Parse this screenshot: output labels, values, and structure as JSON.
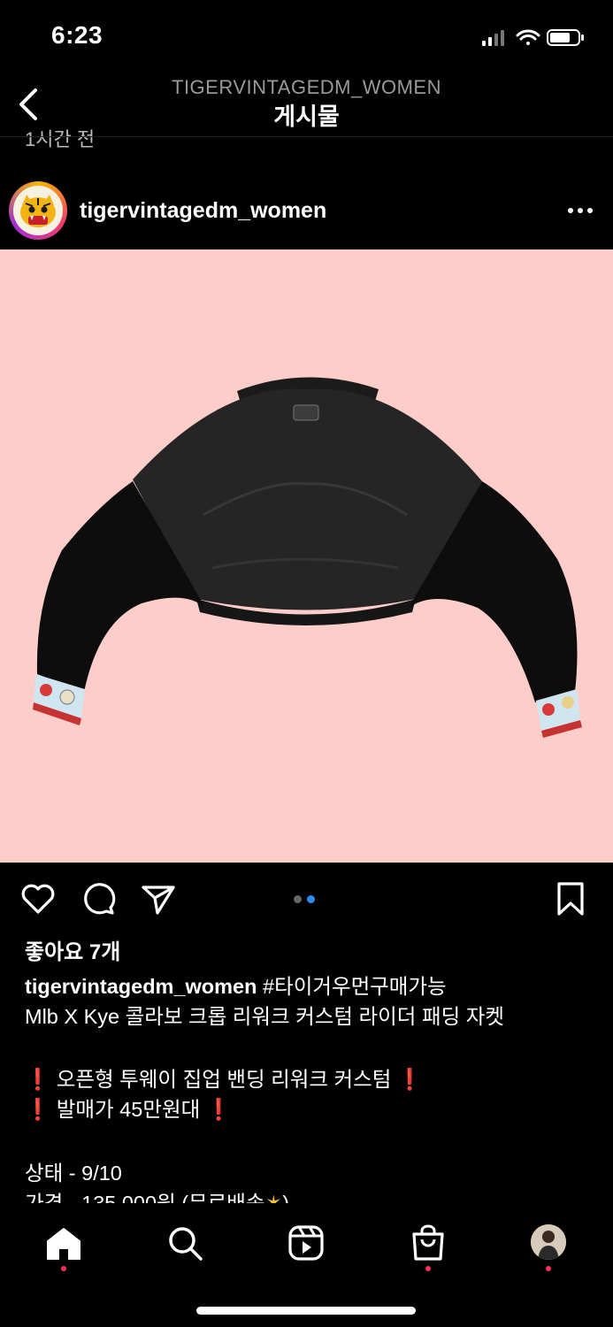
{
  "status": {
    "time": "6:23"
  },
  "header": {
    "account": "TIGERVINTAGEDM_WOMEN",
    "title": "게시물",
    "prev_time_cut": "1시간 전"
  },
  "post": {
    "author": "tigervintagedm_women",
    "likes": "좋아요 7개",
    "carousel": {
      "count": 2,
      "active": 2
    },
    "caption": {
      "username": "tigervintagedm_women",
      "hashtag": "#타이거우먼구매가능",
      "title": "Mlb X Kye 콜라보 크롭 리워크 커스텀 라이더 패딩 자켓",
      "highlight1": "오픈형 투웨이 집업 밴딩 리워크 커스텀",
      "highlight2": "발매가 45만원대",
      "condition": "상태 - 9/10",
      "price_cut": "가격 - 135,000원 (무료배송"
    }
  },
  "colors": {
    "accent": "#ff2f55",
    "carousel_active": "#2d8cf0",
    "photo_bg": "#fdcdc9",
    "emoji_red": "#e02020"
  },
  "icons": [
    "back-icon",
    "more-icon",
    "heart-icon",
    "comment-icon",
    "share-icon",
    "bookmark-icon",
    "home-icon",
    "search-icon",
    "reels-icon",
    "shop-icon",
    "profile-avatar"
  ]
}
